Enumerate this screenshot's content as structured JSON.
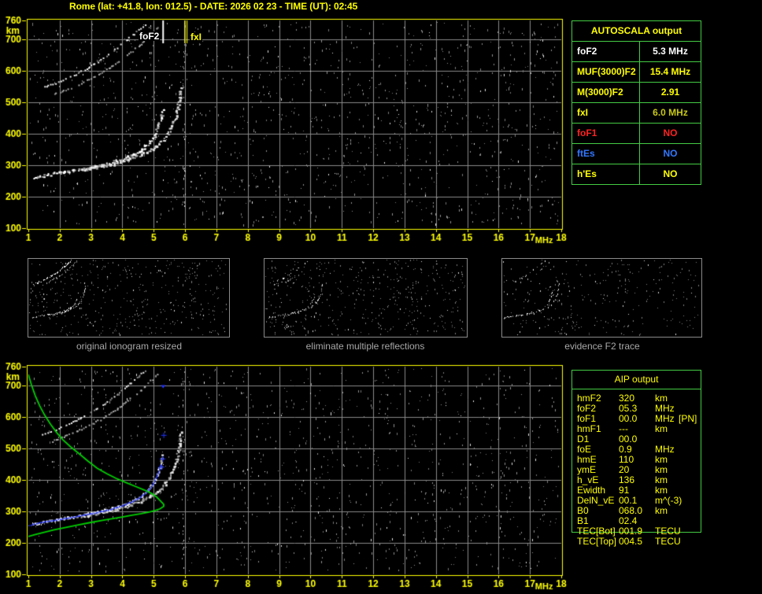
{
  "header": {
    "title": "Rome (lat: +41.8, lon: 012.5) - DATE: 2026 02 23 - TIME (UT): 02:45"
  },
  "colors": {
    "accent_yellow": "#ffff00",
    "table_border_green": "#44cc44",
    "profile_green": "#00d000",
    "restored_trace_blue": "#2233ff",
    "status_red": "#ff2222",
    "status_blue": "#3377ff",
    "trace_white": "#ffffff",
    "fxi_value_color": "#c8c818",
    "grid_gray": "#8a8a8a",
    "noise_gray": "#909090",
    "caption_gray": "#a8a8a8"
  },
  "autoscala": {
    "header": "AUTOSCALA output",
    "rows": [
      {
        "label": "foF2",
        "value": "5.3 MHz",
        "color": "#ffffff"
      },
      {
        "label": "MUF(3000)F2",
        "value": "15.4 MHz",
        "color": "#ffff00"
      },
      {
        "label": "M(3000)F2",
        "value": "2.91",
        "color": "#ffff00"
      },
      {
        "label": "fxI",
        "value": "6.0 MHz",
        "color": "#ffff00",
        "value_color": "#c8c818"
      },
      {
        "label": "foF1",
        "value": "NO",
        "color": "#ff2222"
      },
      {
        "label": "ftEs",
        "value": "NO",
        "color": "#3377ff"
      },
      {
        "label": "h'Es",
        "value": "NO",
        "color": "#ffff00"
      }
    ]
  },
  "aip": {
    "header": "AIP output",
    "rows": [
      {
        "label": "hmF2",
        "value": "320",
        "unit": "km",
        "extra": ""
      },
      {
        "label": "foF2",
        "value": "05.3",
        "unit": "MHz",
        "extra": ""
      },
      {
        "label": "foF1",
        "value": "00.0",
        "unit": "MHz",
        "extra": "[PN]"
      },
      {
        "label": "hmF1",
        "value": "---",
        "unit": "km",
        "extra": ""
      },
      {
        "label": "D1",
        "value": "00.0",
        "unit": "",
        "extra": ""
      },
      {
        "label": "foE",
        "value": "0.9",
        "unit": "MHz",
        "extra": ""
      },
      {
        "label": "hmE",
        "value": "110",
        "unit": "km",
        "extra": ""
      },
      {
        "label": "ymE",
        "value": "20",
        "unit": "km",
        "extra": ""
      },
      {
        "label": "h_vE",
        "value": "136",
        "unit": "km",
        "extra": ""
      },
      {
        "label": "Ewidth",
        "value": "91",
        "unit": "km",
        "extra": ""
      },
      {
        "label": "DelN_vE",
        "value": "00.1",
        "unit": "m^(-3)",
        "extra": ""
      },
      {
        "label": "B0",
        "value": "068.0",
        "unit": "km",
        "extra": ""
      },
      {
        "label": "B1",
        "value": "02.4",
        "unit": "",
        "extra": ""
      },
      {
        "label": "TEC[Bot]",
        "value": "001.9",
        "unit": "TECU",
        "extra": ""
      },
      {
        "label": "TEC[Top]",
        "value": "004.5",
        "unit": "TECU",
        "extra": ""
      }
    ]
  },
  "thumbnails": [
    {
      "caption": "original ionogram resized",
      "seed": 21,
      "noise_count": 420,
      "layers": [
        {
          "series": 0,
          "density": 0.8
        },
        {
          "series": 1,
          "density": 0.65
        },
        {
          "series": 2,
          "density": 0.8
        },
        {
          "series": 3,
          "density": 0.55
        }
      ]
    },
    {
      "caption": "eliminate multiple reflections",
      "seed": 37,
      "noise_count": 470,
      "layers": [
        {
          "series": 0,
          "density": 0.8
        },
        {
          "series": 1,
          "density": 0.65
        },
        {
          "series": 2,
          "density": 0.4
        },
        {
          "series": 3,
          "density": 0.2
        }
      ]
    },
    {
      "caption": "evidence F2 trace",
      "seed": 53,
      "noise_count": 290,
      "layers": [
        {
          "series": 0,
          "density": 0.55
        },
        {
          "series": 1,
          "density": 0.45
        },
        {
          "series": 2,
          "density": 0.35
        },
        {
          "series": 3,
          "density": 0.2
        }
      ]
    }
  ],
  "chart_data": [
    {
      "id": "scaled_ionogram",
      "type": "scatter",
      "title": "",
      "xlabel": "MHz",
      "ylabel": "km",
      "xlim": [
        1,
        18
      ],
      "ylim": [
        100,
        760
      ],
      "grid": true,
      "xticks": [
        1,
        2,
        3,
        4,
        5,
        6,
        7,
        8,
        9,
        10,
        11,
        12,
        13,
        14,
        15,
        16,
        17,
        18
      ],
      "yticks": [
        760,
        700,
        600,
        500,
        400,
        300,
        200,
        100
      ],
      "annotations": [
        {
          "label": "foF2",
          "freq_mhz": 5.3,
          "color": "#ffffff",
          "line_style": "single"
        },
        {
          "label": "fxI",
          "freq_mhz": 6.0,
          "color": "#ffff00",
          "line_style": "double"
        }
      ],
      "series": [
        {
          "name": "F2 trace 1st hop O-mode (foF2 5.3 MHz)",
          "color": "#ffffff",
          "style": "blob",
          "points": [
            [
              1.15,
              258
            ],
            [
              1.45,
              265
            ],
            [
              1.8,
              271
            ],
            [
              2.15,
              277
            ],
            [
              2.5,
              283
            ],
            [
              2.85,
              290
            ],
            [
              3.2,
              297
            ],
            [
              3.55,
              305
            ],
            [
              3.9,
              315
            ],
            [
              4.2,
              326
            ],
            [
              4.45,
              338
            ],
            [
              4.65,
              352
            ],
            [
              4.82,
              368
            ],
            [
              4.97,
              388
            ],
            [
              5.08,
              410
            ],
            [
              5.17,
              435
            ],
            [
              5.23,
              460
            ],
            [
              5.27,
              482
            ]
          ]
        },
        {
          "name": "F2 trace 1st hop X-mode (fxI 6.0 MHz)",
          "color": "#e2e2e2",
          "style": "blob",
          "points": [
            [
              2.7,
              284
            ],
            [
              3.1,
              291
            ],
            [
              3.5,
              299
            ],
            [
              3.9,
              308
            ],
            [
              4.25,
              319
            ],
            [
              4.55,
              331
            ],
            [
              4.85,
              346
            ],
            [
              5.1,
              362
            ],
            [
              5.3,
              381
            ],
            [
              5.47,
              404
            ],
            [
              5.6,
              430
            ],
            [
              5.7,
              458
            ],
            [
              5.77,
              490
            ],
            [
              5.82,
              522
            ],
            [
              5.85,
              552
            ]
          ]
        },
        {
          "name": "F2 trace 2nd hop O-mode",
          "color": "#f2f2f2",
          "style": "dash",
          "points": [
            [
              1.45,
              548
            ],
            [
              1.75,
              558
            ],
            [
              2.1,
              572
            ],
            [
              2.45,
              588
            ],
            [
              2.8,
              606
            ],
            [
              3.15,
              627
            ],
            [
              3.5,
              650
            ],
            [
              3.85,
              676
            ],
            [
              4.15,
              702
            ],
            [
              4.45,
              728
            ],
            [
              4.75,
              750
            ]
          ]
        },
        {
          "name": "F2 trace 2nd hop X-mode",
          "color": "#b0b0b0",
          "style": "dash",
          "points": [
            [
              1.75,
              525
            ],
            [
              2.05,
              537
            ],
            [
              2.4,
              550
            ],
            [
              2.75,
              565
            ],
            [
              3.1,
              583
            ],
            [
              3.45,
              603
            ],
            [
              3.8,
              626
            ],
            [
              4.15,
              652
            ],
            [
              4.5,
              680
            ],
            [
              4.85,
              712
            ],
            [
              5.15,
              744
            ]
          ]
        }
      ],
      "noise": {
        "seed": 11,
        "count": 1300,
        "columns": [
          {
            "freq_mhz": 5.97,
            "count": 42
          }
        ]
      }
    },
    {
      "id": "ionogram_with_restored_trace_and_profile",
      "type": "scatter",
      "title": "",
      "xlabel": "MHz",
      "ylabel": "km",
      "xlim": [
        1,
        18
      ],
      "ylim": [
        100,
        760
      ],
      "grid": true,
      "xticks": [
        1,
        2,
        3,
        4,
        5,
        6,
        7,
        8,
        9,
        10,
        11,
        12,
        13,
        14,
        15,
        16,
        17,
        18
      ],
      "yticks": [
        760,
        700,
        600,
        500,
        400,
        300,
        200,
        100
      ],
      "annotations": [],
      "series": [
        {
          "name": "F2 trace 1st hop O-mode",
          "color": "#ffffff",
          "style": "blob",
          "points": [
            [
              1.15,
              258
            ],
            [
              1.45,
              265
            ],
            [
              1.8,
              271
            ],
            [
              2.15,
              277
            ],
            [
              2.5,
              283
            ],
            [
              2.85,
              290
            ],
            [
              3.2,
              297
            ],
            [
              3.55,
              305
            ],
            [
              3.9,
              315
            ],
            [
              4.2,
              326
            ],
            [
              4.45,
              338
            ],
            [
              4.65,
              352
            ],
            [
              4.82,
              368
            ],
            [
              4.97,
              388
            ],
            [
              5.08,
              410
            ],
            [
              5.17,
              435
            ],
            [
              5.23,
              460
            ],
            [
              5.27,
              482
            ]
          ]
        },
        {
          "name": "F2 trace 1st hop X-mode",
          "color": "#e2e2e2",
          "style": "blob",
          "points": [
            [
              2.7,
              284
            ],
            [
              3.1,
              291
            ],
            [
              3.5,
              299
            ],
            [
              3.9,
              308
            ],
            [
              4.25,
              319
            ],
            [
              4.55,
              331
            ],
            [
              4.85,
              346
            ],
            [
              5.1,
              362
            ],
            [
              5.3,
              381
            ],
            [
              5.47,
              404
            ],
            [
              5.6,
              430
            ],
            [
              5.7,
              458
            ],
            [
              5.77,
              490
            ],
            [
              5.82,
              522
            ],
            [
              5.85,
              552
            ]
          ]
        },
        {
          "name": "F2 trace 2nd hop O-mode",
          "color": "#f2f2f2",
          "style": "dash",
          "points": [
            [
              1.45,
              548
            ],
            [
              1.75,
              558
            ],
            [
              2.1,
              572
            ],
            [
              2.45,
              588
            ],
            [
              2.8,
              606
            ],
            [
              3.15,
              627
            ],
            [
              3.5,
              650
            ],
            [
              3.85,
              676
            ],
            [
              4.15,
              702
            ],
            [
              4.45,
              728
            ],
            [
              4.75,
              750
            ]
          ]
        },
        {
          "name": "F2 trace 2nd hop X-mode",
          "color": "#b0b0b0",
          "style": "dash",
          "points": [
            [
              1.75,
              525
            ],
            [
              2.05,
              537
            ],
            [
              2.4,
              550
            ],
            [
              2.75,
              565
            ],
            [
              3.1,
              583
            ],
            [
              3.45,
              603
            ],
            [
              3.8,
              626
            ],
            [
              4.15,
              652
            ],
            [
              4.5,
              680
            ],
            [
              4.85,
              712
            ],
            [
              5.15,
              744
            ]
          ]
        },
        {
          "name": "restored O-mode trace (AIP fit)",
          "color": "#2233ff",
          "style": "dots",
          "points": [
            [
              1.0,
              255
            ],
            [
              1.3,
              262
            ],
            [
              1.6,
              268
            ],
            [
              2.0,
              274
            ],
            [
              2.4,
              281
            ],
            [
              2.8,
              288
            ],
            [
              3.2,
              296
            ],
            [
              3.6,
              305
            ],
            [
              3.95,
              316
            ],
            [
              4.25,
              328
            ],
            [
              4.5,
              341
            ],
            [
              4.7,
              356
            ],
            [
              4.87,
              373
            ],
            [
              5.0,
              393
            ],
            [
              5.1,
              415
            ],
            [
              5.18,
              438
            ],
            [
              5.22,
              452
            ]
          ]
        },
        {
          "name": "electron density profile (hmF2 320 km, foF2 5.3 MHz)",
          "color": "#00d000",
          "style": "line",
          "points": [
            [
              1.0,
              735
            ],
            [
              1.1,
              702
            ],
            [
              1.22,
              668
            ],
            [
              1.36,
              636
            ],
            [
              1.52,
              606
            ],
            [
              1.7,
              578
            ],
            [
              1.9,
              551
            ],
            [
              2.1,
              528
            ],
            [
              2.35,
              505
            ],
            [
              2.6,
              485
            ],
            [
              2.9,
              460
            ],
            [
              3.2,
              437
            ],
            [
              3.5,
              420
            ],
            [
              3.8,
              405
            ],
            [
              4.1,
              392
            ],
            [
              4.4,
              380
            ],
            [
              4.7,
              368
            ],
            [
              4.95,
              356
            ],
            [
              5.1,
              345
            ],
            [
              5.22,
              333
            ],
            [
              5.32,
              322
            ],
            [
              5.32,
              316
            ],
            [
              5.2,
              308
            ],
            [
              5.05,
              303
            ],
            [
              4.85,
              298
            ],
            [
              4.6,
              293
            ],
            [
              4.3,
              288
            ],
            [
              4.0,
              282
            ],
            [
              3.7,
              277
            ],
            [
              3.4,
              272
            ],
            [
              3.0,
              265
            ],
            [
              2.6,
              257
            ],
            [
              2.2,
              249
            ],
            [
              1.8,
              241
            ],
            [
              1.45,
              232
            ],
            [
              1.2,
              226
            ],
            [
              1.0,
              220
            ]
          ]
        }
      ],
      "markers": [
        {
          "freq_mhz": 5.24,
          "km": 442,
          "glyph": "+"
        },
        {
          "freq_mhz": 5.27,
          "km": 468,
          "glyph": "+"
        },
        {
          "freq_mhz": 5.31,
          "km": 543,
          "glyph": "+"
        },
        {
          "freq_mhz": 5.3,
          "km": 696,
          "glyph": "▼"
        }
      ],
      "noise": {
        "seed": 77,
        "count": 1250,
        "columns": [
          {
            "freq_mhz": 5.95,
            "count": 26
          }
        ]
      }
    }
  ]
}
